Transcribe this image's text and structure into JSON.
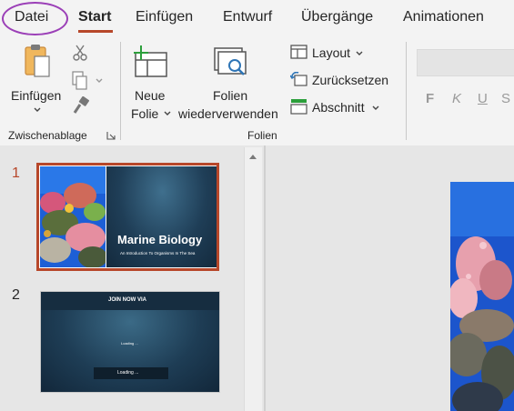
{
  "tabs": {
    "datei": "Datei",
    "start": "Start",
    "einfuegen": "Einfügen",
    "entwurf": "Entwurf",
    "uebergaenge": "Übergänge",
    "animationen": "Animationen"
  },
  "clipboard": {
    "paste_label": "Einfügen",
    "group_label": "Zwischenablage"
  },
  "slides_group": {
    "new_slide_line1": "Neue",
    "new_slide_line2": "Folie",
    "reuse_line1": "Folien",
    "reuse_line2": "wiederverwenden",
    "layout": "Layout",
    "reset": "Zurücksetzen",
    "section": "Abschnitt",
    "group_label": "Folien"
  },
  "font": {
    "bold": "F",
    "italic": "K",
    "underline": "U",
    "strike": "S"
  },
  "thumbnails": [
    {
      "number": "1",
      "title": "Marine Biology",
      "subtitle": "An Introduction To Organisms In The Sea"
    },
    {
      "number": "2",
      "header": "JOIN NOW VIA",
      "small_text": "Loading ...",
      "bar_text": "Loading ..."
    }
  ],
  "colors": {
    "accent": "#b7472a",
    "highlight_circle": "#9b3fb7",
    "ribbon_bg": "#f3f3f3"
  }
}
